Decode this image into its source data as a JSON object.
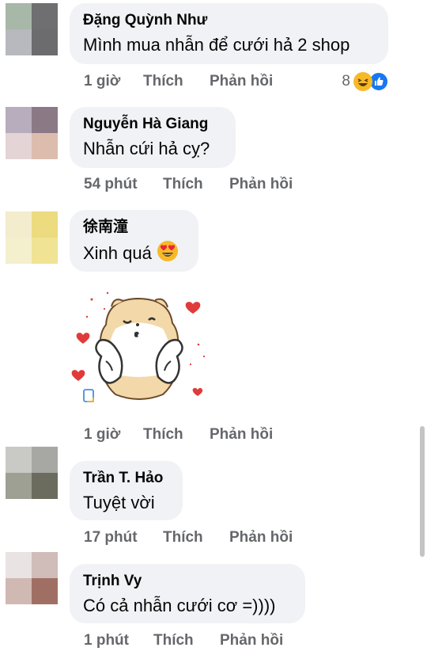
{
  "comments": [
    {
      "author": "Đặng Quỳnh Như",
      "text": "Mình mua nhẫn để cưới hả 2 shop",
      "time": "1 giờ",
      "like_label": "Thích",
      "reply_label": "Phản hồi",
      "reaction_count": "8",
      "reaction_icons": [
        "laugh-reaction-icon",
        "like-reaction-icon"
      ],
      "avatar_colors": [
        "#a7b7a8",
        "#6f6e70",
        "#b7b9be",
        "#6c6c6e"
      ]
    },
    {
      "author": "Nguyễn Hà Giang",
      "text": "Nhẫn cứi hả cỵ?",
      "time": "54 phút",
      "like_label": "Thích",
      "reply_label": "Phản hồi",
      "avatar_colors": [
        "#b7adbd",
        "#8b7986",
        "#e4d4d5",
        "#dcbcad"
      ]
    },
    {
      "author": "徐南潼",
      "text": "Xinh quá",
      "text_emoji": "heart-eyes-emoji-icon",
      "sticker": "hamster-kiss-sticker",
      "time": "1 giờ",
      "like_label": "Thích",
      "reply_label": "Phản hồi",
      "avatar_colors": [
        "#f3eccd",
        "#ecdb7f",
        "#f4efcd",
        "#f0e393"
      ]
    },
    {
      "author": "Trần T. Hảo",
      "text": "Tuyệt vời",
      "time": "17 phút",
      "like_label": "Thích",
      "reply_label": "Phản hồi",
      "avatar_colors": [
        "#c9c9c6",
        "#a7a8a3",
        "#9da092",
        "#6c6c5e"
      ]
    },
    {
      "author": "Trịnh Vy",
      "text": "Có cả nhẫn cưới cơ =))))",
      "time": "1 phút",
      "like_label": "Thích",
      "reply_label": "Phản hồi",
      "avatar_colors": [
        "#e9e3e3",
        "#d0bcb8",
        "#d0b9b3",
        "#a06f64"
      ]
    }
  ],
  "colors": {
    "bubble": "#f0f2f5",
    "secondary_text": "#65676b",
    "primary_text": "#050505",
    "like_blue": "#1877f2",
    "sticker_heart": "#e03b3b"
  }
}
